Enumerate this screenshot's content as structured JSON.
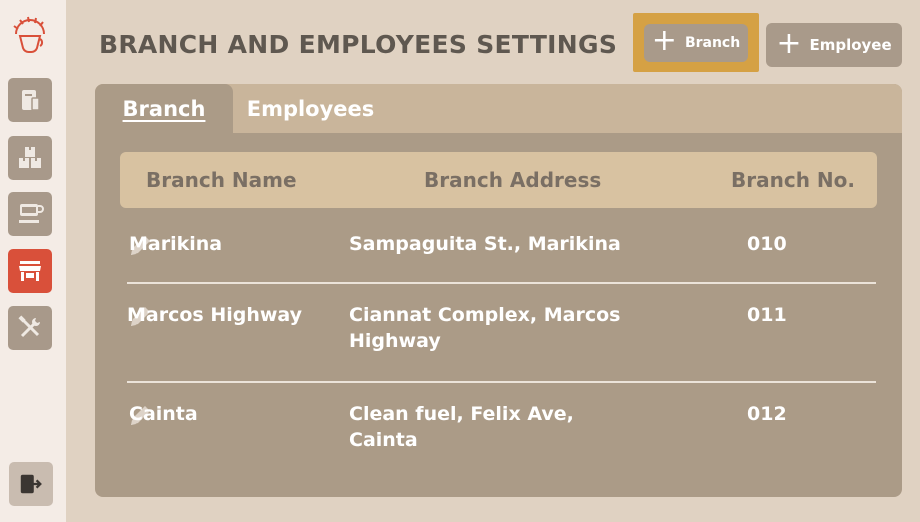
{
  "header": {
    "title": "BRANCH AND EMPLOYEES SETTINGS",
    "add_branch_label": "Branch",
    "add_employee_label": "Employee"
  },
  "tabs": [
    {
      "label": "Branch",
      "active": true
    },
    {
      "label": "Employees",
      "active": false
    }
  ],
  "table": {
    "columns": [
      "Branch Name",
      "Branch Address",
      "Branch No."
    ],
    "rows": [
      {
        "name": "Marikina",
        "address": "Sampaguita St., Marikina",
        "number": "010"
      },
      {
        "name": "Marcos Highway",
        "address": "Ciannat Complex, Marcos Highway",
        "number": "011"
      },
      {
        "name": "Cainta",
        "address": "Clean fuel, Felix Ave, Cainta",
        "number": "012"
      }
    ]
  },
  "sidebar": {
    "items": [
      {
        "icon": "document-icon",
        "active": false
      },
      {
        "icon": "boxes-icon",
        "active": false
      },
      {
        "icon": "coffee-cup-icon",
        "active": false
      },
      {
        "icon": "store-icon",
        "active": true
      },
      {
        "icon": "tools-icon",
        "active": false
      }
    ],
    "logout_icon": "logout-icon"
  },
  "colors": {
    "accent_active": "#d9503a",
    "highlight": "#d5a144",
    "card": "#ab9b87",
    "table_header": "#d8c2a1"
  }
}
